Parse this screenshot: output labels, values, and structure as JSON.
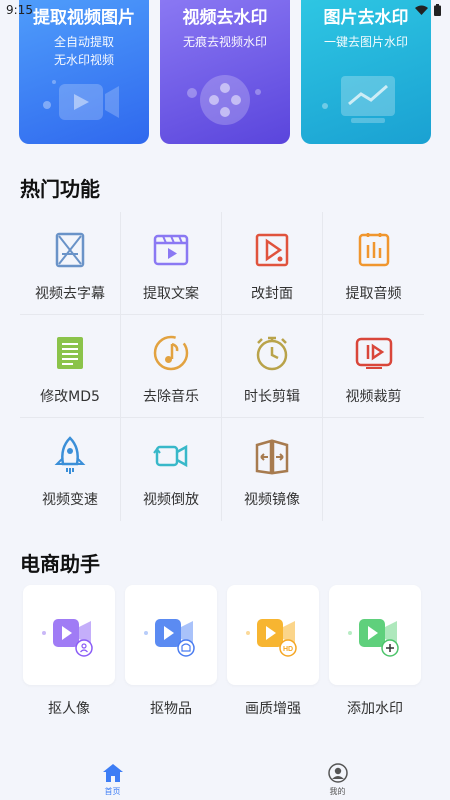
{
  "status_bar": {
    "time": "9:15"
  },
  "banners": [
    {
      "title": "提取视频图片",
      "line1": "全自动提取",
      "line2": "无水印视频"
    },
    {
      "title": "视频去水印",
      "line1": "无痕去视频水印"
    },
    {
      "title": "图片去水印",
      "line1": "一键去图片水印"
    }
  ],
  "sections": {
    "hot": "热门功能",
    "shop": "电商助手"
  },
  "functions": [
    {
      "label": "视频去字幕",
      "icon": "subtitle-remove-icon"
    },
    {
      "label": "提取文案",
      "icon": "clapperboard-icon"
    },
    {
      "label": "改封面",
      "icon": "cover-edit-icon"
    },
    {
      "label": "提取音频",
      "icon": "audio-extract-icon"
    },
    {
      "label": "修改MD5",
      "icon": "document-icon"
    },
    {
      "label": "去除音乐",
      "icon": "music-note-icon"
    },
    {
      "label": "时长剪辑",
      "icon": "timer-icon"
    },
    {
      "label": "视频裁剪",
      "icon": "video-crop-icon"
    },
    {
      "label": "视频变速",
      "icon": "rocket-icon"
    },
    {
      "label": "视频倒放",
      "icon": "reverse-camera-icon"
    },
    {
      "label": "视频镜像",
      "icon": "mirror-icon"
    }
  ],
  "shop_items": [
    {
      "label": "抠人像",
      "icon": "portrait-icon",
      "badge_color": "#8a5cf6"
    },
    {
      "label": "抠物品",
      "icon": "object-icon",
      "badge_color": "#4a7cf0"
    },
    {
      "label": "画质增强",
      "icon": "hd-icon",
      "badge_color": "#f5a623",
      "badge_text": "HD"
    },
    {
      "label": "添加水印",
      "icon": "watermark-add-icon",
      "badge_color": "#4cc46a"
    }
  ],
  "tabs": [
    {
      "label": "首页",
      "icon": "home-icon",
      "active": true
    },
    {
      "label": "我的",
      "icon": "profile-icon",
      "active": false
    }
  ],
  "colors": {
    "accent": "#3d7df5",
    "background": "#f3f5fb"
  }
}
